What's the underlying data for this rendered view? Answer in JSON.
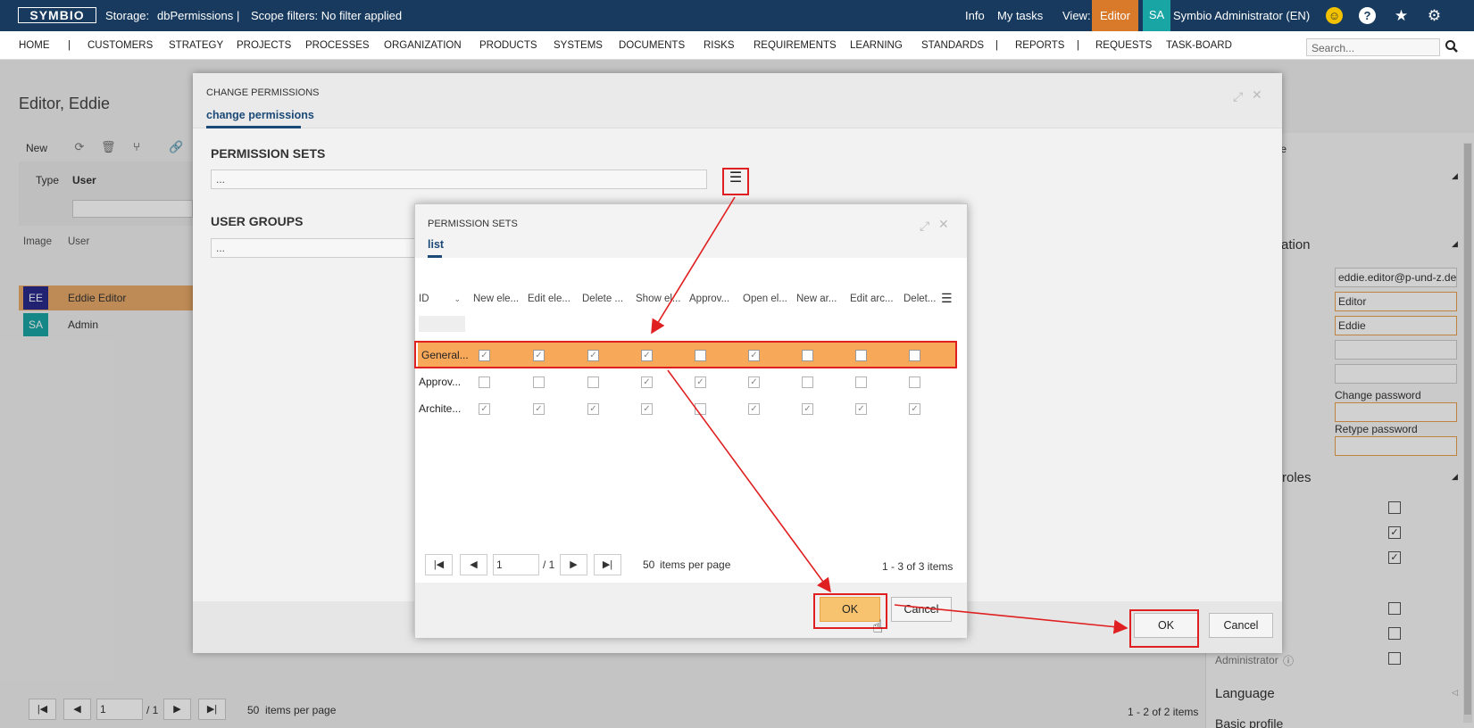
{
  "topbar": {
    "logo": "SYMBIO",
    "storage_label": "Storage:",
    "storage_value": "dbPermissions",
    "separator": "|",
    "scope": "Scope filters: No filter applied",
    "info": "Info",
    "my_tasks": "My tasks",
    "view_label": "View:",
    "view_value": "Editor",
    "user_initials": "SA",
    "user_name": "Symbio Administrator (EN)",
    "icons": [
      "smiley-icon",
      "help-icon",
      "star-icon",
      "gear-icon"
    ]
  },
  "nav": {
    "items": [
      "HOME",
      "|",
      "CUSTOMERS",
      "STRATEGY",
      "PROJECTS",
      "PROCESSES",
      "ORGANIZATION",
      "PRODUCTS",
      "SYSTEMS",
      "DOCUMENTS",
      "RISKS",
      "REQUIREMENTS",
      "LEARNING",
      "STANDARDS",
      "|",
      "REPORTS",
      "|",
      "REQUESTS",
      "TASK-BOARD"
    ],
    "search_placeholder": "Search..."
  },
  "bg": {
    "title": "Editor, Eddie",
    "toolbar_new": "New",
    "filter_type_label": "Type",
    "filter_type_value": "User",
    "col_image": "Image",
    "col_user": "User",
    "rows": [
      {
        "initials": "EE",
        "name": "Eddie Editor",
        "selected": true,
        "color": "#2a2a8c"
      },
      {
        "initials": "SA",
        "name": "Admin",
        "selected": false,
        "color": "#1aa5a5"
      }
    ],
    "pager": {
      "page": "1",
      "of": "/ 1",
      "per_page": "50",
      "per_page_label": "items per page",
      "summary": "1 - 2 of 2 items"
    }
  },
  "right_panel": {
    "header_fragment": "te",
    "section_info_fragment": "ation",
    "email": "eddie.editor@p-und-z.de",
    "last_name": "Editor",
    "first_name": "Eddie",
    "change_password": "Change password",
    "retype_password": "Retype password",
    "roles_fragment": "roles",
    "role_checks": [
      false,
      true,
      true,
      false,
      false,
      false
    ],
    "administrator_label": "Administrator",
    "language": "Language",
    "basic_profile": "Basic profile"
  },
  "change_permissions": {
    "title": "CHANGE PERMISSIONS",
    "tab": "change permissions",
    "permission_sets_heading": "PERMISSION SETS",
    "permission_sets_value": "...",
    "user_groups_heading": "USER GROUPS",
    "user_groups_value": "...",
    "ok": "OK",
    "cancel": "Cancel"
  },
  "permission_sets": {
    "title": "PERMISSION SETS",
    "tab": "list",
    "columns": [
      "ID",
      "New ele...",
      "Edit ele...",
      "Delete ...",
      "Show el...",
      "Approv...",
      "Open el...",
      "New ar...",
      "Edit arc...",
      "Delet..."
    ],
    "rows": [
      {
        "id": "General...",
        "selected": true,
        "checks": [
          true,
          true,
          true,
          true,
          false,
          true,
          false,
          false,
          false
        ]
      },
      {
        "id": "Approv...",
        "selected": false,
        "checks": [
          false,
          false,
          false,
          true,
          true,
          true,
          false,
          false,
          false
        ]
      },
      {
        "id": "Archite...",
        "selected": false,
        "checks": [
          true,
          true,
          true,
          true,
          false,
          true,
          true,
          true,
          true
        ]
      }
    ],
    "pager": {
      "page": "1",
      "of": "/ 1",
      "per_page": "50",
      "per_page_label": "items per page",
      "summary": "1 - 3 of 3 items"
    },
    "ok": "OK",
    "cancel": "Cancel"
  },
  "colors": {
    "topbar": "#173a5e",
    "accent_orange": "#d97a2b",
    "selection": "#f7a859",
    "annotation_red": "#e02020",
    "primary_button": "#f7c36e"
  }
}
